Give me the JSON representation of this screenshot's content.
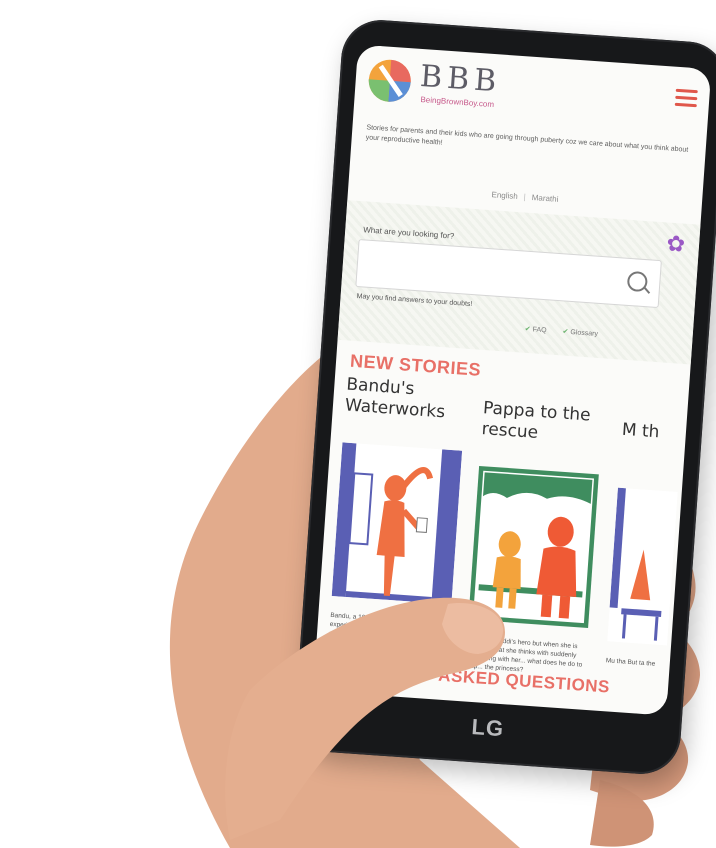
{
  "app": {
    "brand_name": "BBB",
    "brand_url": "BeingBrownBoy.com",
    "tagline": "Stories for parents and their kids who are going through puberty coz we care about what you think about your reproductive health!",
    "languages": [
      "English",
      "Marathi"
    ],
    "language_separator": "|"
  },
  "search": {
    "label": "What are you looking for?",
    "placeholder": "",
    "help_text": "May you find answers to your doubts!",
    "quick_links": [
      "FAQ",
      "Glossary"
    ]
  },
  "sections": {
    "new_stories": "NEW STORIES",
    "faq": "ASKED QUESTIONS"
  },
  "stories": [
    {
      "title": "Bandu's Waterworks",
      "blurb": "Bandu, a 10 and half years old boy is experiencing something new. He has a lot of questions about how his body..."
    },
    {
      "title": "Pappa to the rescue",
      "blurb": "Pappa is Guddi's hero but when she is anxious what she thinks with suddenly happening with her... what does he do to help... the princess?"
    },
    {
      "title": "M th",
      "blurb": "Mu tha But ta the"
    }
  ],
  "device": {
    "brand": "LG"
  },
  "colors": {
    "accent": "#e87067",
    "menu": "#e0574b",
    "gear": "#9a58c5",
    "check": "#6bb36e"
  }
}
